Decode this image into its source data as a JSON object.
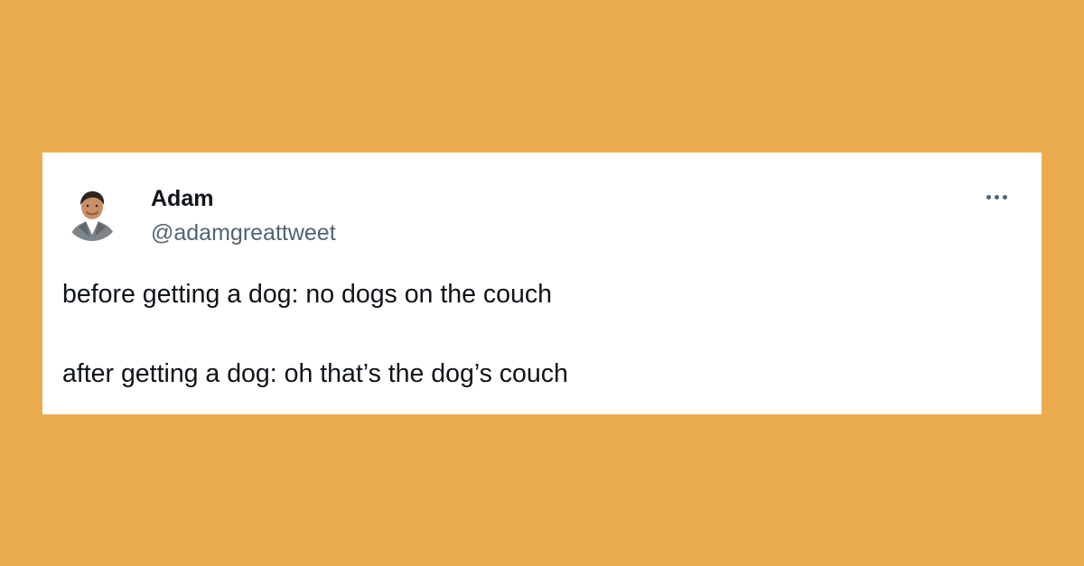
{
  "tweet": {
    "author": {
      "display_name": "Adam",
      "handle": "@adamgreattweet"
    },
    "text_lines": [
      "before getting a dog: no dogs on the couch",
      "after getting a dog: oh that’s the dog’s couch"
    ]
  },
  "colors": {
    "page_background": "#ebac4f",
    "card_background": "#ffffff",
    "primary_text": "#0f1419",
    "secondary_text": "#536471"
  },
  "icons": {
    "more": "more-options-icon",
    "avatar": "profile-photo"
  }
}
